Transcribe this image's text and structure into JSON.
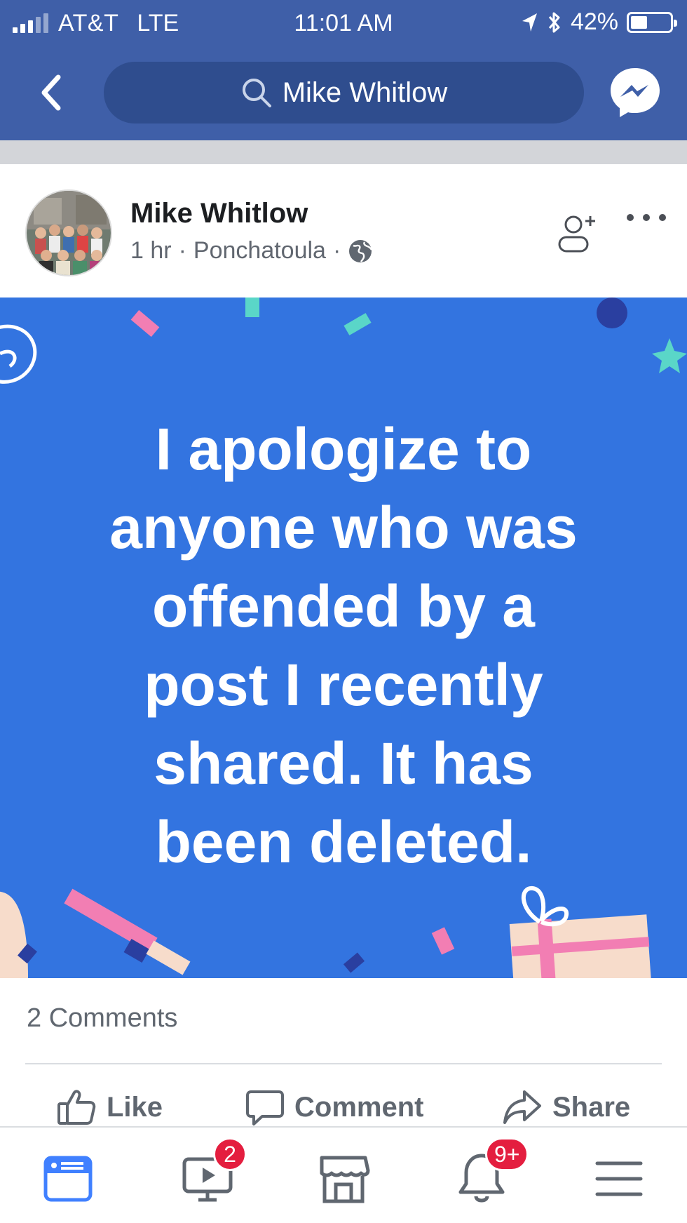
{
  "status_bar": {
    "carrier": "AT&T",
    "network": "LTE",
    "time": "11:01 AM",
    "battery_percent": "42%",
    "battery_level": 0.42,
    "icons": [
      "signal-icon",
      "location-arrow-icon",
      "bluetooth-icon",
      "battery-icon"
    ]
  },
  "nav": {
    "search_text": "Mike Whitlow",
    "back_icon": "chevron-left-icon",
    "messenger_icon": "messenger-icon"
  },
  "post": {
    "author": "Mike Whitlow",
    "time_ago": "1 hr",
    "location": "Ponchatoula",
    "separator": "·",
    "privacy_icon": "globe-icon",
    "body_lines": [
      "I apologize to",
      "anyone who was",
      "offended by a",
      "post I recently",
      "shared. It has",
      "been deleted."
    ],
    "background_color": "#3374e0",
    "comments_count": "2 Comments"
  },
  "actions": {
    "like": "Like",
    "comment": "Comment",
    "share": "Share"
  },
  "tabbar": {
    "video_badge": "2",
    "notifications_badge": "9+",
    "active_tab": "news-feed",
    "accent_color": "#4080ff"
  }
}
